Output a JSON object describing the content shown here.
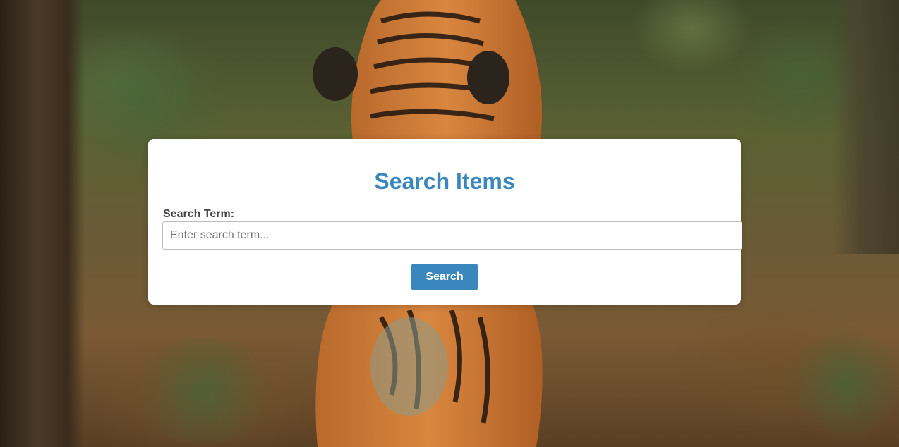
{
  "background": {
    "image_subject": "tiger-in-forest"
  },
  "form": {
    "title": "Search Items",
    "field_label": "Search Term:",
    "input_value": "",
    "input_placeholder": "Enter search term...",
    "submit_label": "Search"
  },
  "colors": {
    "accent": "#3a87bd",
    "card_background": "#ffffff",
    "label_text": "#444444"
  }
}
